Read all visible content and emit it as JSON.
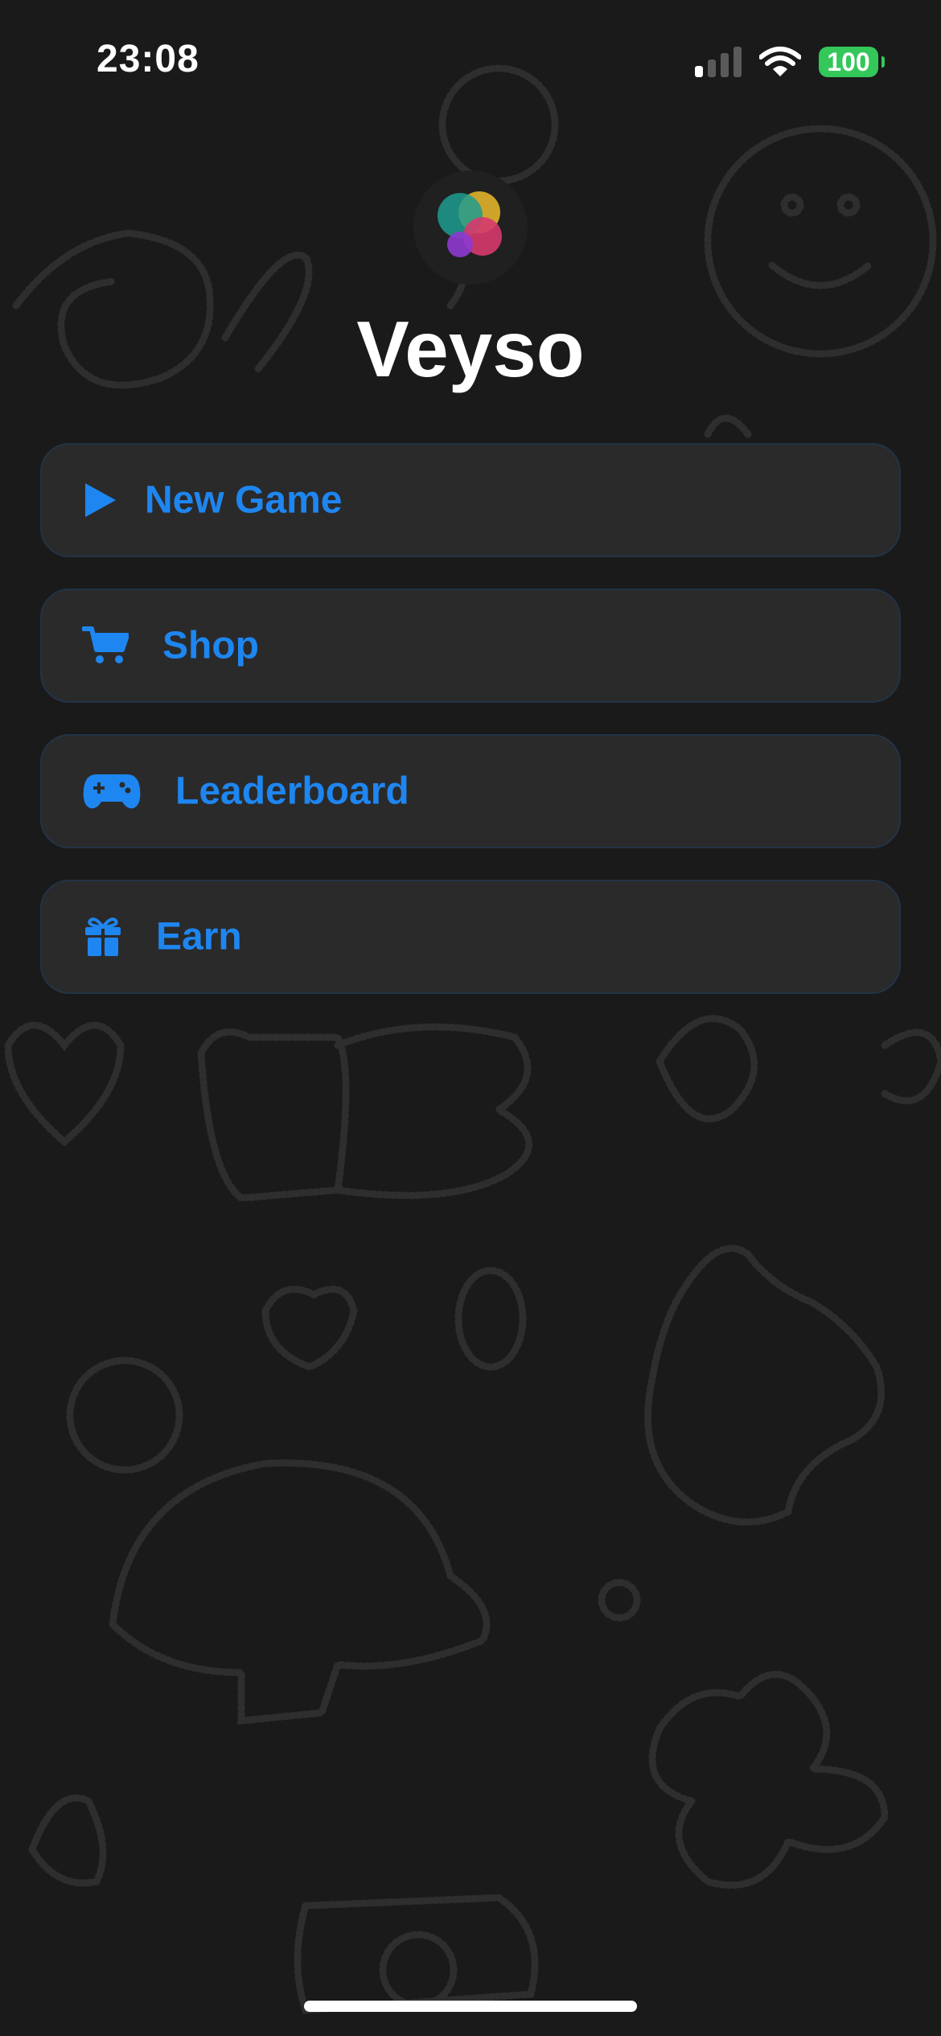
{
  "status_bar": {
    "time": "23:08",
    "battery_level": "100",
    "signal_bars_active": 1,
    "signal_bars_total": 4,
    "icons": [
      "cellular-signal-icon",
      "wifi-icon",
      "battery-icon"
    ]
  },
  "app": {
    "title": "Veyso",
    "logo_icon": "game-center-bubbles-icon"
  },
  "menu": {
    "items": [
      {
        "label": "New Game",
        "icon": "play-icon"
      },
      {
        "label": "Shop",
        "icon": "cart-icon"
      },
      {
        "label": "Leaderboard",
        "icon": "gamecontroller-icon"
      },
      {
        "label": "Earn",
        "icon": "gift-icon"
      }
    ]
  },
  "colors": {
    "background": "#1a1a1a",
    "button_background": "#2a2a2b",
    "accent": "#1e86f0",
    "battery": "#34c759",
    "title": "#ffffff"
  }
}
